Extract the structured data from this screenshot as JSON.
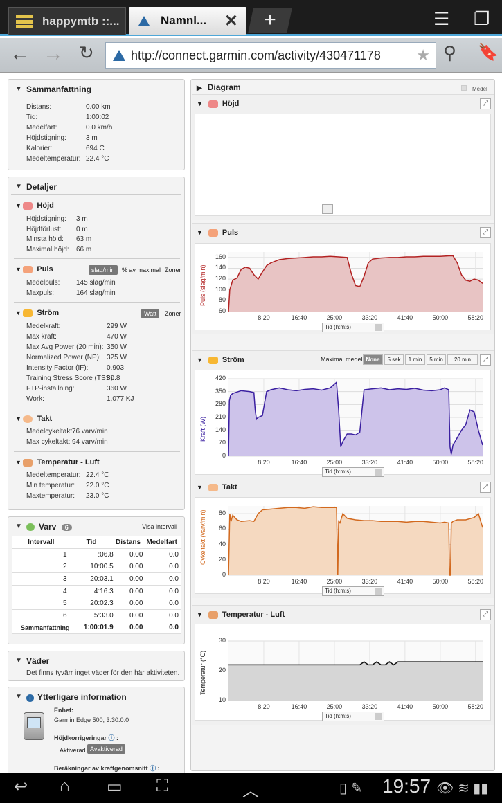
{
  "browser": {
    "tabs": [
      {
        "label": "happymtb ::..."
      },
      {
        "label": "Namnl..."
      }
    ],
    "new_tab": "+",
    "url": "http://connect.garmin.com/activity/430471178"
  },
  "summary": {
    "title": "Sammanfattning",
    "rows": [
      [
        "Distans:",
        "0.00 km"
      ],
      [
        "Tid:",
        "1:00:02"
      ],
      [
        "Medelfart:",
        "0.0 km/h"
      ],
      [
        "Höjdstigning:",
        "3 m"
      ],
      [
        "Kalorier:",
        "694 C"
      ],
      [
        "Medeltemperatur:",
        "22.4 °C"
      ]
    ]
  },
  "details": {
    "title": "Detaljer",
    "hojd": {
      "title": "Höjd",
      "rows": [
        [
          "Höjdstigning:",
          "3 m"
        ],
        [
          "Höjdförlust:",
          "0 m"
        ],
        [
          "Minsta höjd:",
          "63 m"
        ],
        [
          "Maximal höjd:",
          "66 m"
        ]
      ]
    },
    "puls": {
      "title": "Puls",
      "btn1": "slag/min",
      "btn2": "% av maximal",
      "btn3": "Zoner",
      "rows": [
        [
          "Medelpuls:",
          "145 slag/min"
        ],
        [
          "Maxpuls:",
          "164 slag/min"
        ]
      ]
    },
    "strom": {
      "title": "Ström",
      "btn1": "Watt",
      "btn2": "Zoner",
      "rows": [
        [
          "Medelkraft:",
          "299 W"
        ],
        [
          "Max kraft:",
          "470 W"
        ],
        [
          "Max Avg Power (20 min):",
          "350 W"
        ],
        [
          "Normalized Power (NP):",
          "325 W"
        ],
        [
          "Intensity Factor (IF):",
          "0.903"
        ],
        [
          "Training Stress Score (TSS):",
          "80.8"
        ],
        [
          "FTP-inställning:",
          "360 W"
        ],
        [
          "Work:",
          "1,077 KJ"
        ]
      ]
    },
    "takt": {
      "title": "Takt",
      "rows": [
        [
          "Medelcykeltakt:",
          "76 varv/min"
        ],
        [
          "Max cykeltakt:",
          "94 varv/min"
        ]
      ]
    },
    "temp": {
      "title": "Temperatur - Luft",
      "rows": [
        [
          "Medeltemperatur:",
          "22.4 °C"
        ],
        [
          "Min temperatur:",
          "22.0 °C"
        ],
        [
          "Maxtemperatur:",
          "23.0 °C"
        ]
      ]
    }
  },
  "laps": {
    "title": "Varv",
    "count": "6",
    "link": "Visa intervall",
    "headers": [
      "Intervall",
      "Tid",
      "Distans",
      "Medelfart"
    ],
    "rows": [
      [
        "1",
        ":06.8",
        "0.00",
        "0.0"
      ],
      [
        "2",
        "10:00.5",
        "0.00",
        "0.0"
      ],
      [
        "3",
        "20:03.1",
        "0.00",
        "0.0"
      ],
      [
        "4",
        "4:16.3",
        "0.00",
        "0.0"
      ],
      [
        "5",
        "20:02.3",
        "0.00",
        "0.0"
      ],
      [
        "6",
        "5:33.0",
        "0.00",
        "0.0"
      ]
    ],
    "total": [
      "Sammanfattning",
      "1:00:01.9",
      "0.00",
      "0.0"
    ]
  },
  "weather": {
    "title": "Väder",
    "text": "Det finns tyvärr inget väder för den här aktiviteten."
  },
  "more": {
    "title": "Ytterligare information",
    "enhet_label": "Enhet:",
    "enhet": "Garmin Edge 500, 3.30.0.0",
    "hojdkorr": "Höjdkorrigeringar",
    "aktiverad": "Aktiverad",
    "avaktiverad": "Avaktiverad",
    "berakn": "Beräkningar av kraftgenomsnitt"
  },
  "diagram": {
    "title": "Diagram",
    "medel": "Medel",
    "time_select": "Tid (h:m:s)",
    "xticks": [
      "8:20",
      "16:40",
      "25:00",
      "33:20",
      "41:40",
      "50:00",
      "58:20"
    ],
    "power_label": "Maximal medel:",
    "power_opts": [
      "None",
      "5 sek",
      "1 min",
      "5 min",
      "20 min"
    ]
  },
  "chart_data": [
    {
      "type": "line",
      "title": "Höjd",
      "series": []
    },
    {
      "type": "area",
      "title": "Puls",
      "ylabel": "Puls (slag/min)",
      "xlabel": "Tid (h:m:s)",
      "ylim": [
        60,
        170
      ],
      "yticks": [
        "160",
        "140",
        "120",
        "100",
        "80",
        "60"
      ],
      "color": "#b22222",
      "fill": "#e8c4c4",
      "x": [
        0,
        0.3,
        1,
        2,
        3,
        4,
        5,
        6,
        7,
        8,
        9,
        10,
        12,
        14,
        16,
        18,
        20,
        22,
        24,
        26,
        28,
        29,
        30,
        31,
        32,
        33,
        34,
        35,
        36,
        38,
        40,
        42,
        44,
        46,
        48,
        50,
        52,
        53,
        54,
        55,
        56,
        57,
        58,
        59,
        60
      ],
      "values": [
        60,
        100,
        118,
        122,
        138,
        142,
        140,
        128,
        120,
        133,
        145,
        150,
        156,
        158,
        159,
        160,
        161,
        161,
        162,
        161,
        160,
        130,
        108,
        106,
        125,
        150,
        157,
        158,
        159,
        160,
        160,
        161,
        161,
        162,
        162,
        162,
        163,
        163,
        150,
        128,
        118,
        116,
        120,
        118,
        112
      ]
    },
    {
      "type": "area",
      "title": "Ström",
      "ylabel": "Kraft (W)",
      "xlabel": "Tid (h:m:s)",
      "ylim": [
        0,
        420
      ],
      "yticks": [
        "420",
        "350",
        "280",
        "210",
        "140",
        "70",
        "0"
      ],
      "color": "#3a1fa0",
      "fill": "#cdc3ea",
      "x": [
        0,
        0.2,
        0.5,
        1,
        3,
        5,
        6,
        6.3,
        6.6,
        7,
        8,
        9,
        10,
        12,
        14,
        16,
        18,
        20,
        22,
        24,
        25.5,
        26,
        26.5,
        27,
        28,
        29,
        30,
        31,
        32,
        34,
        36,
        38,
        40,
        42,
        44,
        46,
        48,
        50,
        51,
        52,
        52.3,
        52.6,
        53,
        54,
        55,
        56,
        57,
        58,
        59,
        60
      ],
      "values": [
        0,
        300,
        330,
        340,
        355,
        350,
        345,
        250,
        200,
        210,
        220,
        350,
        360,
        370,
        360,
        355,
        362,
        365,
        358,
        370,
        400,
        250,
        50,
        80,
        120,
        120,
        115,
        130,
        360,
        365,
        370,
        360,
        365,
        362,
        368,
        358,
        355,
        360,
        370,
        360,
        50,
        10,
        60,
        100,
        140,
        170,
        250,
        240,
        140,
        60
      ]
    },
    {
      "type": "area",
      "title": "Takt",
      "ylabel": "Cykeltakt (varv/min)",
      "xlabel": "Tid (h:m:s)",
      "ylim": [
        0,
        90
      ],
      "yticks": [
        "80",
        "60",
        "40",
        "20",
        "0"
      ],
      "color": "#d2691e",
      "fill": "#f5d9c0",
      "x": [
        0,
        0.3,
        0.6,
        1,
        2,
        3,
        5,
        6,
        7,
        8,
        10,
        12,
        14,
        16,
        18,
        20,
        22,
        24,
        25.5,
        25.8,
        26,
        26.3,
        27,
        28,
        30,
        32,
        34,
        36,
        38,
        40,
        42,
        44,
        46,
        48,
        50,
        51,
        52,
        52.2,
        52.4,
        52.6,
        53,
        54,
        56,
        58,
        59,
        60
      ],
      "values": [
        0,
        80,
        70,
        78,
        72,
        70,
        71,
        70,
        80,
        85,
        86,
        87,
        88,
        88,
        87,
        89,
        88,
        88,
        88,
        0,
        70,
        68,
        80,
        74,
        72,
        71,
        71,
        70,
        70,
        70,
        69,
        70,
        70,
        69,
        68,
        69,
        68,
        0,
        0,
        68,
        70,
        72,
        72,
        75,
        80,
        62
      ]
    },
    {
      "type": "area",
      "title": "Temperatur - Luft",
      "ylabel": "Temperatur (°C)",
      "xlabel": "Tid (h:m:s)",
      "ylim": [
        10,
        30
      ],
      "yticks": [
        "30",
        "20",
        "10"
      ],
      "color": "#111",
      "fill": "#d6d6d6",
      "x": [
        0,
        10,
        20,
        30,
        31,
        32,
        33,
        34,
        35,
        36,
        37,
        38,
        39,
        40,
        50,
        60
      ],
      "values": [
        22,
        22,
        22,
        22,
        22,
        23,
        22,
        22,
        23,
        22,
        22,
        23,
        22,
        23,
        23,
        23
      ]
    }
  ],
  "status": {
    "time": "19:57"
  }
}
